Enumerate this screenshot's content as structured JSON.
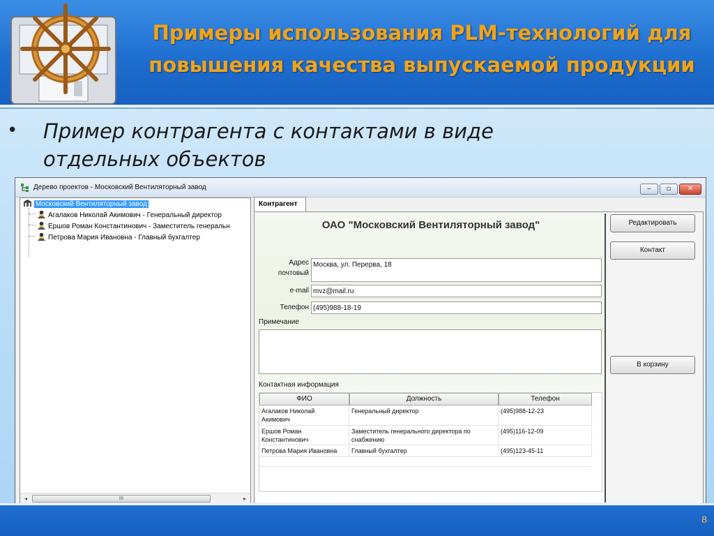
{
  "slide": {
    "title_line1": "Примеры использования PLM-технологий для",
    "title_line2": "повышения качества выпускаемой  продукции",
    "bullet_symbol": "•",
    "bullet_line1": "Пример контрагента с контактами в виде",
    "bullet_line2": "отдельных объектов",
    "page_number": "8",
    "colors": {
      "header_blue": "#1f6fd0",
      "title_orange": "#f2a316",
      "background": "#bfe0f8"
    },
    "logo_icon": "ship-wheel-logo-icon"
  },
  "window": {
    "title": "Дерево проектов - Московский Вентиляторный завод",
    "controls": {
      "minimize": "‒",
      "maximize": "▫",
      "close": "✕"
    }
  },
  "tree": {
    "root": "Московский Вентиляторный завод",
    "children": [
      "Агалаков Николай Акимович - Генеральный директор",
      "Ершов Роман Константинович - Заместитель генеральн",
      "Петрова Мария Ивановна  - Главный бухгалтер"
    ],
    "scroll_left": "◂",
    "scroll_right": "▸",
    "scroll_thumb": "III"
  },
  "tab": {
    "label": "Контрагент"
  },
  "form": {
    "company_name": "ОАО \"Московский Вентиляторный завод\"",
    "address_label_line1": "Адрес",
    "address_label_line2": "почтовый",
    "address_value": "Москва, ул. Перерва, 18",
    "email_label": "e-mail",
    "email_value": "mvz@mail.ru",
    "phone_label": "Телефон",
    "phone_value": "(495)988-18-19",
    "note_label": "Примечание",
    "note_value": "",
    "contacts_label": "Контактная информация"
  },
  "contacts": {
    "columns": [
      "ФИО",
      "Должность",
      "Телефон"
    ],
    "rows": [
      {
        "name_line1": "Агалаков Николай",
        "name_line2": "Акимович",
        "position_line1": "Генеральный директор",
        "position_line2": "",
        "phone": "(495)988-12-23"
      },
      {
        "name_line1": "Ершов Роман",
        "name_line2": "Константинович",
        "position_line1": "Заместитель генерального директора по",
        "position_line2": "снабжению",
        "phone": "(495)116-12-09"
      },
      {
        "name_line1": "Петрова Мария Ивановна",
        "name_line2": "",
        "position_line1": "Главный бухгалтер",
        "position_line2": "",
        "phone": "(495)123-45-11"
      }
    ]
  },
  "buttons": {
    "edit": "Редактировать",
    "contact": "Контакт",
    "to_trash": "В корзину"
  }
}
